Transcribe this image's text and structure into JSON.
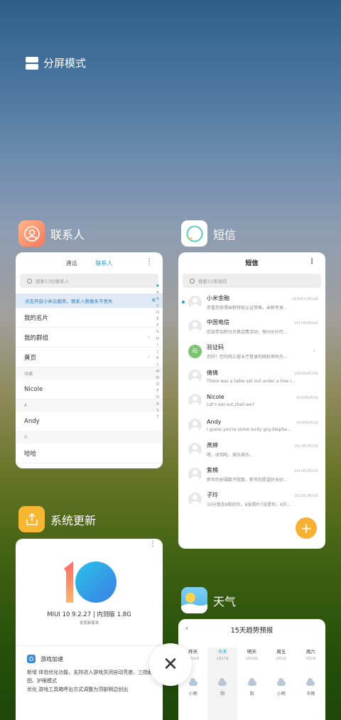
{
  "split_screen": {
    "label": "分屏模式"
  },
  "contacts": {
    "app_name": "联系人",
    "tabs": [
      "通话",
      "联系人"
    ],
    "more": "⋮",
    "search_placeholder": "搜索13位联系人",
    "banner": "点击开启小米云服务，联系人数据永不丢失",
    "banner_close": "×",
    "rows": [
      {
        "kind": "row",
        "label": "我的名片",
        "chevron": false
      },
      {
        "kind": "row",
        "label": "我的群组",
        "chevron": true
      },
      {
        "kind": "row",
        "label": "黄页",
        "chevron": true
      },
      {
        "kind": "section",
        "label": "收藏"
      },
      {
        "kind": "row",
        "label": "Nicole",
        "chevron": false
      },
      {
        "kind": "section",
        "label": "A"
      },
      {
        "kind": "row",
        "label": "Andy",
        "chevron": false
      },
      {
        "kind": "section",
        "label": "H"
      },
      {
        "kind": "row",
        "label": "哈哈",
        "chevron": false
      }
    ],
    "alpha_index": [
      "♥",
      "A",
      "B",
      "C",
      "D",
      "E",
      "F",
      "G",
      "H",
      "I",
      "J",
      "K",
      "L",
      "M",
      "N",
      "O",
      "P",
      "Q",
      "R",
      "S",
      "T"
    ]
  },
  "sms": {
    "app_name": "短信",
    "title": "短信",
    "more": "⋮",
    "search_placeholder": "搜索12条短信",
    "messages": [
      {
        "name": "小米金融",
        "time": "2018年12月14日",
        "snippet": "恭喜您获得米粉特权认证资格，米粉专享...",
        "unread": true,
        "avatar": "",
        "chevron": false
      },
      {
        "name": "中国电信",
        "time": "2017年6月30日",
        "snippet": "欢迎参加积分兑换话费活动，每500分可...",
        "unread": false,
        "avatar": "",
        "chevron": false
      },
      {
        "name": "验证码",
        "time": "",
        "snippet": "您好！您的网上营业厅登录的随机密码为...",
        "unread": false,
        "avatar": "码",
        "chevron": true
      },
      {
        "name": "倩倩",
        "time": "2016年6月10日",
        "snippet": "There was a table set out under a tree i...",
        "unread": false,
        "avatar": "",
        "chevron": false
      },
      {
        "name": "Nicole",
        "time": "2016年6月1日",
        "snippet": "Let's eat out,shall we?",
        "unread": false,
        "avatar": "",
        "chevron": false
      },
      {
        "name": "Andy",
        "time": "2016年6月1日",
        "snippet": "I guess you're some lucky guy.Stepha...",
        "unread": false,
        "avatar": "",
        "chevron": false
      },
      {
        "name": "燕婷",
        "time": "2013年2月22日",
        "snippet": "嗯，收到啦，周乐周乐。",
        "unread": false,
        "avatar": "",
        "chevron": false
      },
      {
        "name": "紫楠",
        "time": "2013年2月22日",
        "snippet": "新年的祝福数不胜数，新年的愿望好多好...",
        "unread": false,
        "avatar": "",
        "chevron": false
      },
      {
        "name": "子玲",
        "time": "2013年2月22日",
        "snippet": "10分想念9阳的你，8张照片7张是你，6只...",
        "unread": false,
        "avatar": "",
        "chevron": false
      }
    ],
    "fab": "+"
  },
  "update": {
    "app_name": "系统更新",
    "more": "⋮",
    "version": "MIUI 10 9.2.27 | 内测版 1.8G",
    "new_version": "发现新版本",
    "feature_title": "游戏加速",
    "notes": [
      "新增 体验优化功能，支持进入游戏关闭自动亮度、三指截图、护眼模式",
      "优化 游戏工具箱呼出方式调整为顶部侧边划出"
    ]
  },
  "weather": {
    "app_name": "天气",
    "title": "15天趋势预报",
    "back": "‹",
    "days": [
      {
        "day": "昨天",
        "date": "3月26日",
        "cond": "小雨"
      },
      {
        "day": "今天",
        "date": "3月27日",
        "cond": "阴"
      },
      {
        "day": "明天",
        "date": "3月28日",
        "cond": "阴"
      },
      {
        "day": "周五",
        "date": "3月1日",
        "cond": "小雨"
      },
      {
        "day": "周六",
        "date": "3月2日",
        "cond": "中雨"
      }
    ]
  },
  "close": {
    "symbol": "✕"
  },
  "colors": {
    "accent_blue": "#2a95d8",
    "fab_orange": "#f6b033",
    "sms_green_avatar": "#7bc470"
  }
}
